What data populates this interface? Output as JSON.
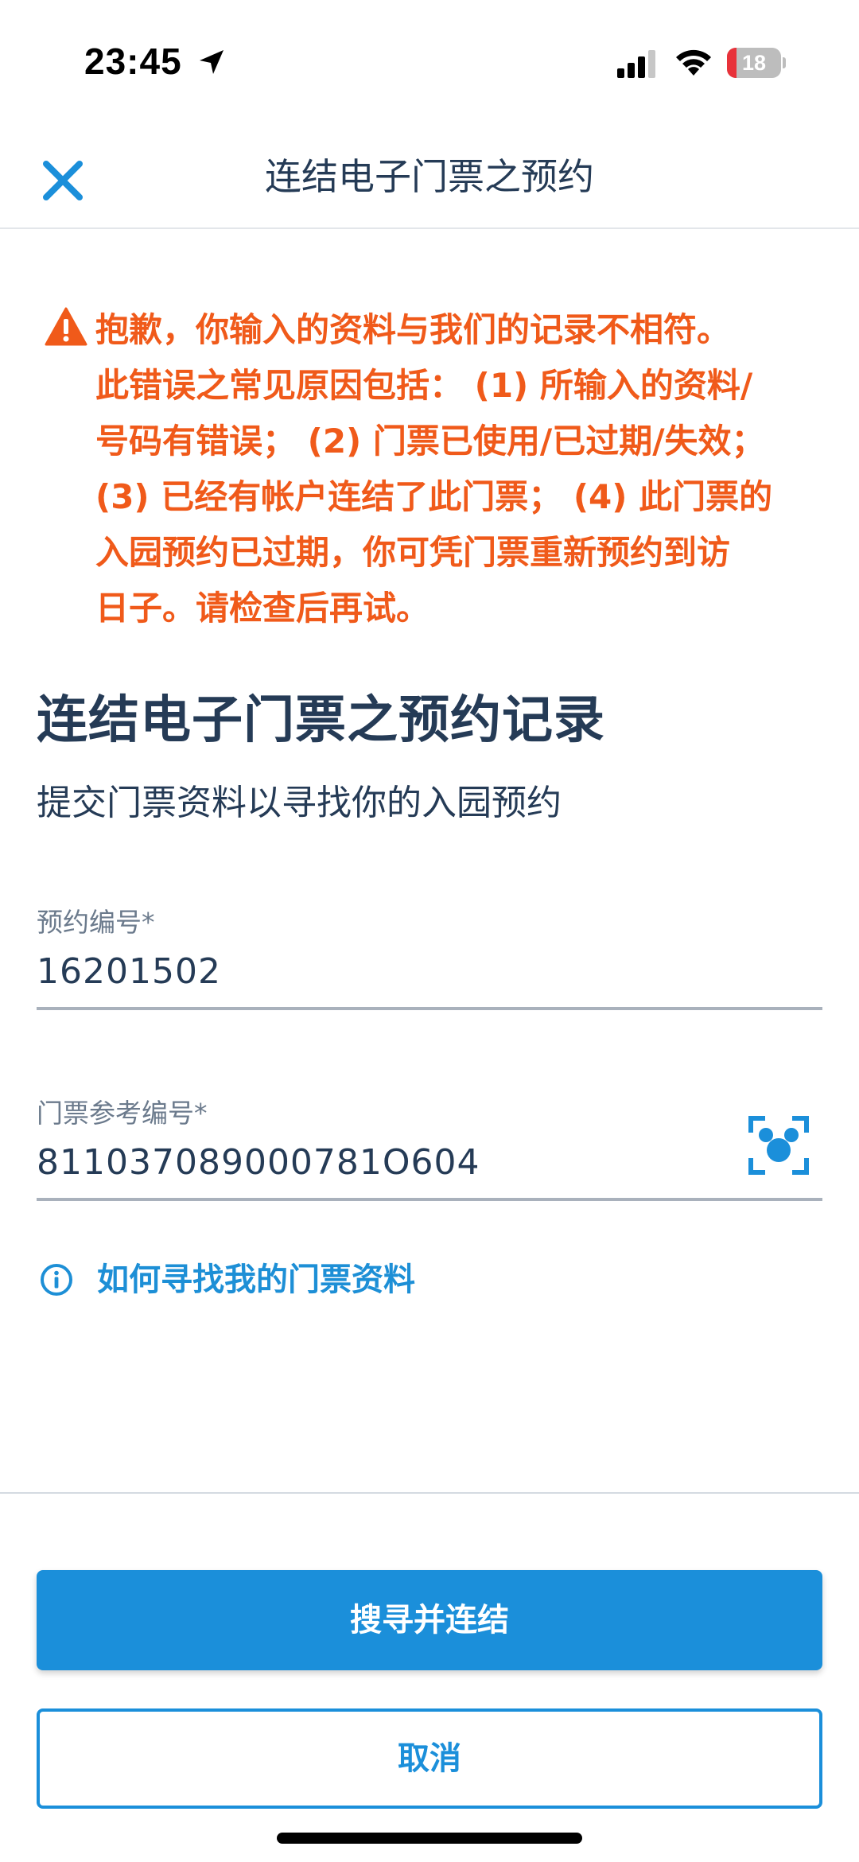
{
  "status_bar": {
    "time": "23:45",
    "battery_level": "18",
    "battery_fraction": 0.18,
    "icons": [
      "location-arrow-icon",
      "cellular-signal-icon",
      "wifi-icon",
      "battery-icon"
    ]
  },
  "header": {
    "close_icon": "close-icon",
    "title": "连结电子门票之预约"
  },
  "error": {
    "icon": "warning-icon",
    "color": "#f05a1a",
    "message": "抱歉，你输入的资料与我们的记录不相符。\n此错误之常见原因包括： (1) 所输入的资料/\n号码有错误； (2) 门票已使用/已过期/失效；\n(3) 已经有帐户连结了此门票； (4) 此门票的\n入园预约已过期，你可凭门票重新预约到访\n日子。请检查后再试。"
  },
  "section": {
    "title": "连结电子门票之预约记录",
    "subtitle": "提交门票资料以寻找你的入园预约"
  },
  "fields": {
    "reservation": {
      "label": "预约编号*",
      "value": "16201502"
    },
    "ticket": {
      "label": "门票参考编号*",
      "value": "811037089000781O604",
      "scan_icon": "mickey-scan-icon"
    }
  },
  "help_link": {
    "icon": "info-icon",
    "label": "如何寻找我的门票资料"
  },
  "actions": {
    "primary_label": "搜寻并连结",
    "secondary_label": "取消"
  },
  "colors": {
    "accent": "#1b8fda",
    "text": "#253b56",
    "error": "#f05a1a"
  }
}
